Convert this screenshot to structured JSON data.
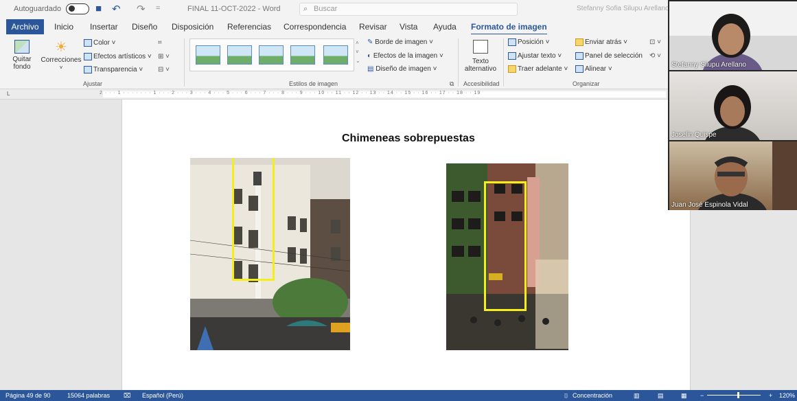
{
  "titlebar": {
    "autosave_label": "Autoguardado",
    "doc_title": "FINAL 11-OCT-2022  -  Word",
    "search_placeholder": "Buscar",
    "user_name": "Stefanny Sofia Silupu Arellano"
  },
  "tabs": [
    "Archivo",
    "Inicio",
    "Insertar",
    "Diseño",
    "Disposición",
    "Referencias",
    "Correspondencia",
    "Revisar",
    "Vista",
    "Ayuda",
    "Formato de imagen"
  ],
  "ribbon": {
    "ajustar": {
      "quitar_fondo": "Quitar fondo",
      "correcciones": "Correcciones",
      "color": "Color ˅",
      "efectos_artisticos": "Efectos artísticos ˅",
      "transparencia": "Transparencia ˅",
      "label": "Ajustar"
    },
    "estilos": {
      "borde": "Borde de imagen ˅",
      "efectos": "Efectos de la imagen ˅",
      "diseno": "Diseño de imagen ˅",
      "label": "Estilos de imagen"
    },
    "accesibilidad": {
      "texto": "Texto alternativo",
      "label": "Accesibilidad"
    },
    "organizar": {
      "posicion": "Posición ˅",
      "ajustar_texto": "Ajustar texto ˅",
      "traer": "Traer adelante ˅",
      "enviar": "Enviar atrás ˅",
      "panel": "Panel de selección",
      "alinear": "Alinear ˅",
      "label": "Organizar"
    }
  },
  "ruler": {
    "corner": "L",
    "numbers": "2 · · · 1 · · · · · · · 1 · · · 2 · · · 3 · · · 4 · · · 5 · · · 6 · · · 7 · · · 8 · · · 9 · · · 10 · · 11 · · 12 · · 13 · · 14 · · 15 · · 16 · · 17 · · 18 · · 19"
  },
  "document": {
    "heading": "Chimeneas sobrepuestas"
  },
  "participants": [
    {
      "name": "Stefanny Silupu Arellano"
    },
    {
      "name": "Joselin Quispe"
    },
    {
      "name": "Juan José Espinola Vidal"
    }
  ],
  "status": {
    "page": "Página 49 de 90",
    "words": "15064 palabras",
    "language": "Español (Perú)",
    "focus": "Concentración",
    "zoom": "120%"
  },
  "colors": {
    "accent": "#2b579a",
    "highlight_box": "#f4ee1a"
  }
}
